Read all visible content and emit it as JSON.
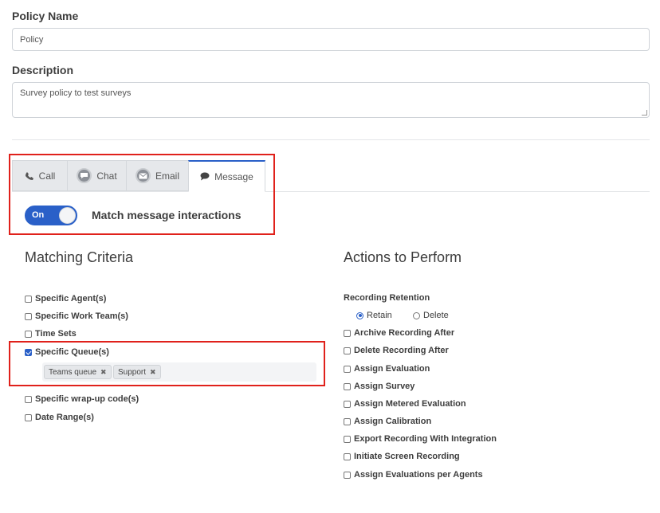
{
  "policy_name": {
    "label": "Policy Name",
    "value": "Policy"
  },
  "description": {
    "label": "Description",
    "value": "Survey policy to test surveys"
  },
  "tabs": [
    {
      "label": "Call",
      "icon": "phone-icon"
    },
    {
      "label": "Chat",
      "icon": "chat-icon"
    },
    {
      "label": "Email",
      "icon": "email-icon"
    },
    {
      "label": "Message",
      "icon": "message-icon",
      "active": true
    }
  ],
  "toggle": {
    "state_label": "On",
    "text": "Match message interactions",
    "on": true
  },
  "matching_criteria": {
    "title": "Matching Criteria",
    "items": [
      {
        "label": "Specific Agent(s)",
        "checked": false
      },
      {
        "label": "Specific Work Team(s)",
        "checked": false
      },
      {
        "label": "Time Sets",
        "checked": false
      },
      {
        "label": "Specific Queue(s)",
        "checked": true
      },
      {
        "label": "Specific wrap-up code(s)",
        "checked": false
      },
      {
        "label": "Date Range(s)",
        "checked": false
      }
    ],
    "queues": [
      "Teams queue",
      "Support"
    ]
  },
  "actions": {
    "title": "Actions to Perform",
    "retention_label": "Recording Retention",
    "retention_options": [
      {
        "label": "Retain",
        "checked": true
      },
      {
        "label": "Delete",
        "checked": false
      }
    ],
    "items": [
      {
        "label": "Archive Recording After",
        "checked": false
      },
      {
        "label": "Delete Recording After",
        "checked": false
      },
      {
        "label": "Assign Evaluation",
        "checked": false
      },
      {
        "label": "Assign Survey",
        "checked": false
      },
      {
        "label": "Assign Metered Evaluation",
        "checked": false
      },
      {
        "label": "Assign Calibration",
        "checked": false
      },
      {
        "label": "Export Recording With Integration",
        "checked": false
      },
      {
        "label": "Initiate Screen Recording",
        "checked": false
      },
      {
        "label": "Assign Evaluations per Agents",
        "checked": false
      }
    ]
  },
  "colors": {
    "accent": "#2a60c8",
    "highlight": "#e0211b"
  }
}
